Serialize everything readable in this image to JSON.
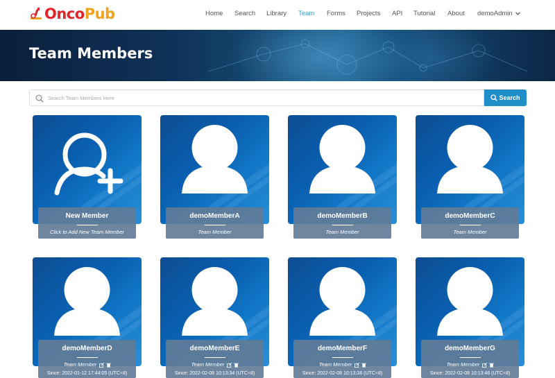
{
  "brand": {
    "name_part1": "Onco",
    "name_part2": "Pub"
  },
  "nav": {
    "items": [
      {
        "label": "Home"
      },
      {
        "label": "Search"
      },
      {
        "label": "Library"
      },
      {
        "label": "Team",
        "active": true
      },
      {
        "label": "Forms"
      },
      {
        "label": "Projects"
      },
      {
        "label": "API"
      },
      {
        "label": "Tutorial"
      },
      {
        "label": "About"
      },
      {
        "label": "demoAdmin"
      }
    ]
  },
  "hero": {
    "title": "Team Members"
  },
  "search": {
    "placeholder": "Search Team Members Here",
    "button_label": "Search"
  },
  "colors": {
    "accent": "#1f8fc9",
    "active_nav": "#2a9fd6",
    "card_label_bg": "#627c98"
  },
  "cards": [
    {
      "name": "New Member",
      "subtitle": "Click to Add New Team Member",
      "icon": "add-user-icon"
    },
    {
      "name": "demoMemberA",
      "subtitle": "Team Member",
      "icon": "user-icon"
    },
    {
      "name": "demoMemberB",
      "subtitle": "Team Member",
      "icon": "user-icon"
    },
    {
      "name": "demoMemberC",
      "subtitle": "Team Member",
      "icon": "user-icon"
    },
    {
      "name": "demoMemberD",
      "subtitle": "Team Member",
      "date": "Since: 2022-01-12 17:44:05 (UTC+8)",
      "icon": "user-icon"
    },
    {
      "name": "demoMemberE",
      "subtitle": "Team Member",
      "date": "Since: 2022-02-08 10:13:34 (UTC+8)",
      "icon": "user-icon"
    },
    {
      "name": "demoMemberF",
      "subtitle": "Team Member",
      "date": "Since: 2022-02-08 10:13:36 (UTC+8)",
      "icon": "user-icon"
    },
    {
      "name": "demoMemberG",
      "subtitle": "Team Member",
      "date": "Since: 2022-02-08 10:13:46 (UTC+8)",
      "icon": "user-icon"
    }
  ]
}
